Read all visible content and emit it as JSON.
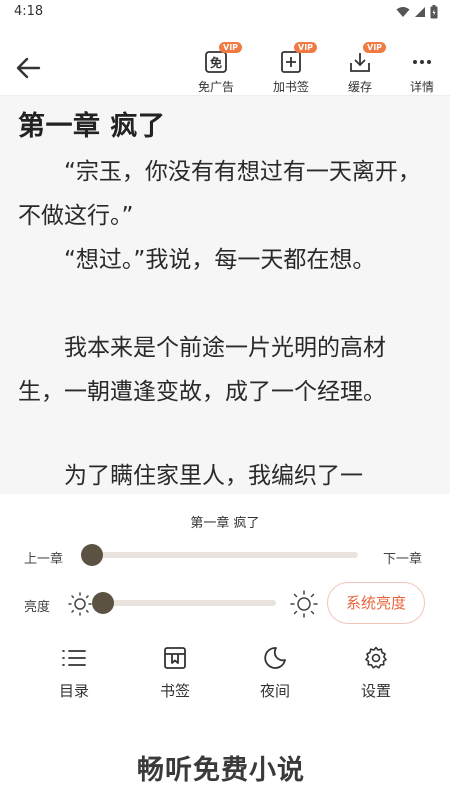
{
  "status_bar": {
    "time": "4:18"
  },
  "toolbar": {
    "items": [
      {
        "label": "免广告",
        "badge": "VIP",
        "icon": "no-ads-icon"
      },
      {
        "label": "加书签",
        "badge": "VIP",
        "icon": "add-bookmark-icon"
      },
      {
        "label": "缓存",
        "badge": "VIP",
        "icon": "download-icon"
      },
      {
        "label": "详情",
        "icon": "more-dots-icon"
      }
    ]
  },
  "reader": {
    "chapter_title": "第一章 疯了",
    "paragraphs": [
      "“宗玉，你没有有想过有一天离开，不做这行。”",
      "“想过。”我说，每一天都在想。",
      "我本来是个前途一片光明的高材生，一朝遭逢变故，成了一个经理。",
      "为了瞒住家里人，我编织了一"
    ]
  },
  "panel": {
    "chapter_title": "第一章 疯了",
    "prev_chapter": "上一章",
    "next_chapter": "下一章",
    "chapter_progress": 0,
    "brightness_label": "亮度",
    "brightness_level": 0,
    "system_brightness": "系统亮度",
    "nav": [
      {
        "label": "目录",
        "icon": "list-icon"
      },
      {
        "label": "书签",
        "icon": "bookmark-icon"
      },
      {
        "label": "夜间",
        "icon": "moon-icon"
      },
      {
        "label": "设置",
        "icon": "gear-icon"
      }
    ]
  },
  "promo": {
    "text": "畅听免费小说"
  },
  "colors": {
    "accent": "#e8663d",
    "knob": "#5b5244",
    "reader_bg": "#f6f6f6",
    "badge": "#f07a42"
  }
}
